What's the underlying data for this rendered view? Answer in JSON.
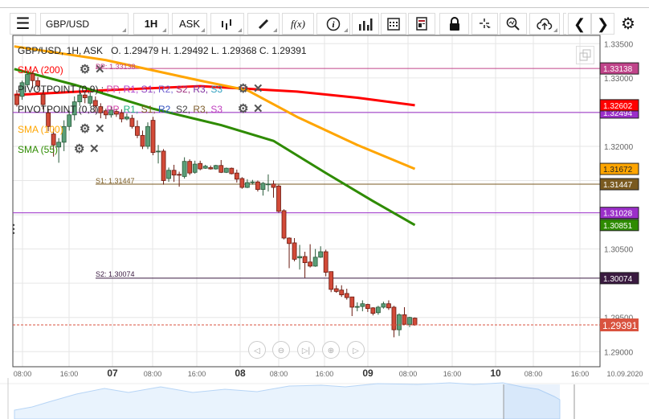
{
  "toolbar": {
    "menu_icon": "hamburger-icon",
    "symbol": "GBP/USD",
    "timeframe": "1H",
    "price_side": "ASK",
    "buttons": [
      "chart-type-icon",
      "draw-icon",
      "indicators-icon",
      "info-icon",
      "volume-icon",
      "calendar-icon",
      "news-icon",
      "lock-icon",
      "crosshair-icon",
      "zoom-icon",
      "cloud-upload-icon",
      "chevron-left-icon",
      "chevron-right-icon",
      "gear-icon"
    ],
    "fx_label": "f(x)"
  },
  "legend": {
    "header": "GBP/USD, 1H, ASK",
    "ohlc": "O. 1.29479 H. 1.29492 L. 1.29368 C. 1.29391",
    "indicators": [
      {
        "label": "SMA (200)",
        "color": "#ff0000"
      },
      {
        "label": "PIVOTPOINT (0,9)",
        "color": "#222222",
        "parts": [
          {
            "t": "PP",
            "c": "#d040a8"
          },
          {
            "t": "R1",
            "c": "#b040d0"
          },
          {
            "t": "S1",
            "c": "#9040c0"
          },
          {
            "t": "R2",
            "c": "#7060d0"
          },
          {
            "t": "S2",
            "c": "#a03080"
          },
          {
            "t": "R3",
            "c": "#8030a0"
          },
          {
            "t": "S3",
            "c": "#30a0c0"
          }
        ]
      },
      {
        "label": "PIVOTPOINT (0,8)",
        "color": "#222222",
        "parts": [
          {
            "t": "PP",
            "c": "#d040a8"
          },
          {
            "t": "R1",
            "c": "#20b080"
          },
          {
            "t": "S1",
            "c": "#806020"
          },
          {
            "t": "R2",
            "c": "#3050c0"
          },
          {
            "t": "S2",
            "c": "#404040"
          },
          {
            "t": "R3",
            "c": "#806030"
          },
          {
            "t": "S3",
            "c": "#c040c0"
          }
        ]
      },
      {
        "label": "SMA (100)",
        "color": "#ffa500"
      },
      {
        "label": "SMA (55)",
        "color": "#2e8b00"
      }
    ]
  },
  "chart_data": {
    "type": "candlestick",
    "symbol": "GBP/USD",
    "ylim": [
      1.2875,
      1.3375
    ],
    "y_ticks": [
      "1.33500",
      "1.33000",
      "1.32000",
      "1.31500",
      "1.30500",
      "1.29500",
      "1.29000"
    ],
    "x_ticks": [
      {
        "label": "08:00",
        "bold": false
      },
      {
        "label": "16:00",
        "bold": false
      },
      {
        "label": "07",
        "bold": true
      },
      {
        "label": "08:00",
        "bold": false
      },
      {
        "label": "16:00",
        "bold": false
      },
      {
        "label": "08",
        "bold": true
      },
      {
        "label": "08:00",
        "bold": false
      },
      {
        "label": "16:00",
        "bold": false
      },
      {
        "label": "09",
        "bold": true
      },
      {
        "label": "08:00",
        "bold": false
      },
      {
        "label": "16:00",
        "bold": false
      },
      {
        "label": "10",
        "bold": true
      },
      {
        "label": "08:00",
        "bold": false
      },
      {
        "label": "16:00",
        "bold": false
      },
      {
        "label": "10.09.2020",
        "bold": false
      }
    ],
    "up_color": "#5a9e78",
    "down_color": "#d24a38",
    "candles_ohlc": [
      [
        1.3275,
        1.3282,
        1.3258,
        1.3261
      ],
      [
        1.3273,
        1.3296,
        1.3268,
        1.3293
      ],
      [
        1.329,
        1.331,
        1.3287,
        1.3305
      ],
      [
        1.3306,
        1.331,
        1.3285,
        1.3296
      ],
      [
        1.3296,
        1.3301,
        1.3282,
        1.3288
      ],
      [
        1.3276,
        1.3282,
        1.3254,
        1.3261
      ],
      [
        1.3249,
        1.3255,
        1.3222,
        1.3229
      ],
      [
        1.3218,
        1.3226,
        1.3185,
        1.3202
      ],
      [
        1.3199,
        1.3212,
        1.3176,
        1.3206
      ],
      [
        1.3206,
        1.3238,
        1.3193,
        1.3229
      ],
      [
        1.3229,
        1.3252,
        1.3223,
        1.3246
      ],
      [
        1.3246,
        1.3273,
        1.3238,
        1.3265
      ],
      [
        1.3265,
        1.3282,
        1.3259,
        1.3275
      ],
      [
        1.3275,
        1.328,
        1.3263,
        1.3271
      ],
      [
        1.3263,
        1.3279,
        1.3259,
        1.3273
      ],
      [
        1.3267,
        1.3273,
        1.3249,
        1.3259
      ],
      [
        1.3258,
        1.3263,
        1.3241,
        1.3249
      ],
      [
        1.3252,
        1.3255,
        1.324,
        1.3246
      ],
      [
        1.3246,
        1.3259,
        1.3242,
        1.3253
      ],
      [
        1.3251,
        1.3255,
        1.3243,
        1.3247
      ],
      [
        1.3249,
        1.3254,
        1.3235,
        1.324
      ],
      [
        1.324,
        1.3248,
        1.3238,
        1.3243
      ],
      [
        1.3241,
        1.3246,
        1.3226,
        1.3229
      ],
      [
        1.3229,
        1.3238,
        1.3212,
        1.3216
      ],
      [
        1.3216,
        1.3223,
        1.3196,
        1.32
      ],
      [
        1.32,
        1.3235,
        1.3196,
        1.3229
      ],
      [
        1.3238,
        1.3243,
        1.3187,
        1.3191
      ],
      [
        1.3192,
        1.3202,
        1.3175,
        1.3193
      ],
      [
        1.3193,
        1.3196,
        1.3144,
        1.315
      ],
      [
        1.3153,
        1.3169,
        1.3148,
        1.3165
      ],
      [
        1.3165,
        1.3173,
        1.3148,
        1.3158
      ],
      [
        1.3159,
        1.3163,
        1.3141,
        1.3158
      ],
      [
        1.3156,
        1.3184,
        1.3153,
        1.3178
      ],
      [
        1.3178,
        1.3181,
        1.3158,
        1.3161
      ],
      [
        1.3162,
        1.3179,
        1.316,
        1.3174
      ],
      [
        1.3175,
        1.3179,
        1.3165,
        1.3167
      ],
      [
        1.3168,
        1.3173,
        1.3167,
        1.3171
      ],
      [
        1.3169,
        1.3172,
        1.3166,
        1.3167
      ],
      [
        1.3167,
        1.3173,
        1.3166,
        1.3172
      ],
      [
        1.3172,
        1.318,
        1.3161,
        1.3162
      ],
      [
        1.3162,
        1.3169,
        1.3161,
        1.3168
      ],
      [
        1.3168,
        1.3169,
        1.3159,
        1.316
      ],
      [
        1.3161,
        1.3166,
        1.3147,
        1.3152
      ],
      [
        1.3153,
        1.3155,
        1.3138,
        1.314
      ],
      [
        1.314,
        1.3152,
        1.3139,
        1.3147
      ],
      [
        1.3147,
        1.3151,
        1.3144,
        1.3148
      ],
      [
        1.3148,
        1.315,
        1.3134,
        1.3137
      ],
      [
        1.3137,
        1.3148,
        1.3128,
        1.3146
      ],
      [
        1.3144,
        1.3159,
        1.3134,
        1.3145
      ],
      [
        1.3145,
        1.315,
        1.3125,
        1.314
      ],
      [
        1.3142,
        1.3144,
        1.3103,
        1.3105
      ],
      [
        1.3106,
        1.3108,
        1.3064,
        1.3066
      ],
      [
        1.3066,
        1.3067,
        1.3022,
        1.3058
      ],
      [
        1.3059,
        1.3066,
        1.3032,
        1.3035
      ],
      [
        1.3037,
        1.3056,
        1.302,
        1.3039
      ],
      [
        1.3039,
        1.3046,
        1.3008,
        1.303
      ],
      [
        1.3031,
        1.3057,
        1.3023,
        1.3025
      ],
      [
        1.3025,
        1.305,
        1.3024,
        1.3038
      ],
      [
        1.3038,
        1.3054,
        1.3037,
        1.3046
      ],
      [
        1.3046,
        1.3049,
        1.301,
        1.3016
      ],
      [
        1.3017,
        1.3017,
        1.2987,
        1.2991
      ],
      [
        1.2992,
        1.2997,
        1.2986,
        1.2988
      ],
      [
        1.299,
        1.2997,
        1.298,
        1.2983
      ],
      [
        1.2985,
        1.2992,
        1.2976,
        1.2979
      ],
      [
        1.298,
        1.298,
        1.2952,
        1.2965
      ],
      [
        1.2965,
        1.2972,
        1.2959,
        1.2966
      ],
      [
        1.2966,
        1.2975,
        1.2959,
        1.297
      ],
      [
        1.2969,
        1.297,
        1.2958,
        1.2963
      ],
      [
        1.2964,
        1.2965,
        1.2953,
        1.2956
      ],
      [
        1.2957,
        1.2967,
        1.2954,
        1.2965
      ],
      [
        1.2965,
        1.2973,
        1.2963,
        1.297
      ],
      [
        1.297,
        1.2975,
        1.2961,
        1.2964
      ],
      [
        1.2965,
        1.2967,
        1.2921,
        1.2932
      ],
      [
        1.2932,
        1.2956,
        1.2923,
        1.2954
      ],
      [
        1.2954,
        1.2965,
        1.2939,
        1.294
      ],
      [
        1.294,
        1.2951,
        1.2936,
        1.295
      ],
      [
        1.2949,
        1.295,
        1.2938,
        1.2939
      ]
    ],
    "sma_lines": [
      {
        "name": "SMA (200)",
        "color": "#ff0000",
        "points": [
          [
            0.5,
            1.3275
          ],
          [
            18,
            1.3282
          ],
          [
            36,
            1.3288
          ],
          [
            54.5,
            1.328
          ],
          [
            66,
            1.3271
          ],
          [
            77,
            1.326
          ]
        ],
        "last": "1.32602"
      },
      {
        "name": "SMA (100)",
        "color": "#ffa500",
        "points": [
          [
            0.5,
            1.3346
          ],
          [
            18,
            1.3326
          ],
          [
            36,
            1.3296
          ],
          [
            45,
            1.3282
          ],
          [
            54.5,
            1.3243
          ],
          [
            66,
            1.3202
          ],
          [
            77,
            1.3167
          ]
        ],
        "last": "1.31672"
      },
      {
        "name": "SMA (55)",
        "color": "#2e8b00",
        "points": [
          [
            0.5,
            1.3313
          ],
          [
            12,
            1.329
          ],
          [
            27,
            1.3255
          ],
          [
            40,
            1.3231
          ],
          [
            50,
            1.3208
          ],
          [
            60,
            1.3161
          ],
          [
            69,
            1.312
          ],
          [
            77,
            1.3085
          ]
        ],
        "last": "1.30851"
      }
    ],
    "levels": [
      {
        "value": 1.33138,
        "label": "1.33138",
        "line_label": "PP: 1.33138",
        "color": "#c0448a"
      },
      {
        "value": 1.32494,
        "label": "1.32494",
        "line_label": "",
        "color": "#9b2fc9"
      },
      {
        "value": 1.31447,
        "label": "1.31447",
        "line_label": "S1: 1.31447",
        "color": "#7a5a20"
      },
      {
        "value": 1.31028,
        "label": "1.31028",
        "line_label": "",
        "color": "#9b2fc9"
      },
      {
        "value": 1.30074,
        "label": "1.30074",
        "line_label": "S2: 1.30074",
        "color": "#3a1a40"
      }
    ],
    "current_price": {
      "value": 1.29391,
      "label": "1.29391",
      "color": "#d9533f"
    }
  },
  "navigator": {
    "controls": [
      "scroll-left-icon",
      "zoom-out-icon",
      "go-to-end-icon",
      "zoom-in-icon",
      "scroll-right-icon"
    ]
  }
}
